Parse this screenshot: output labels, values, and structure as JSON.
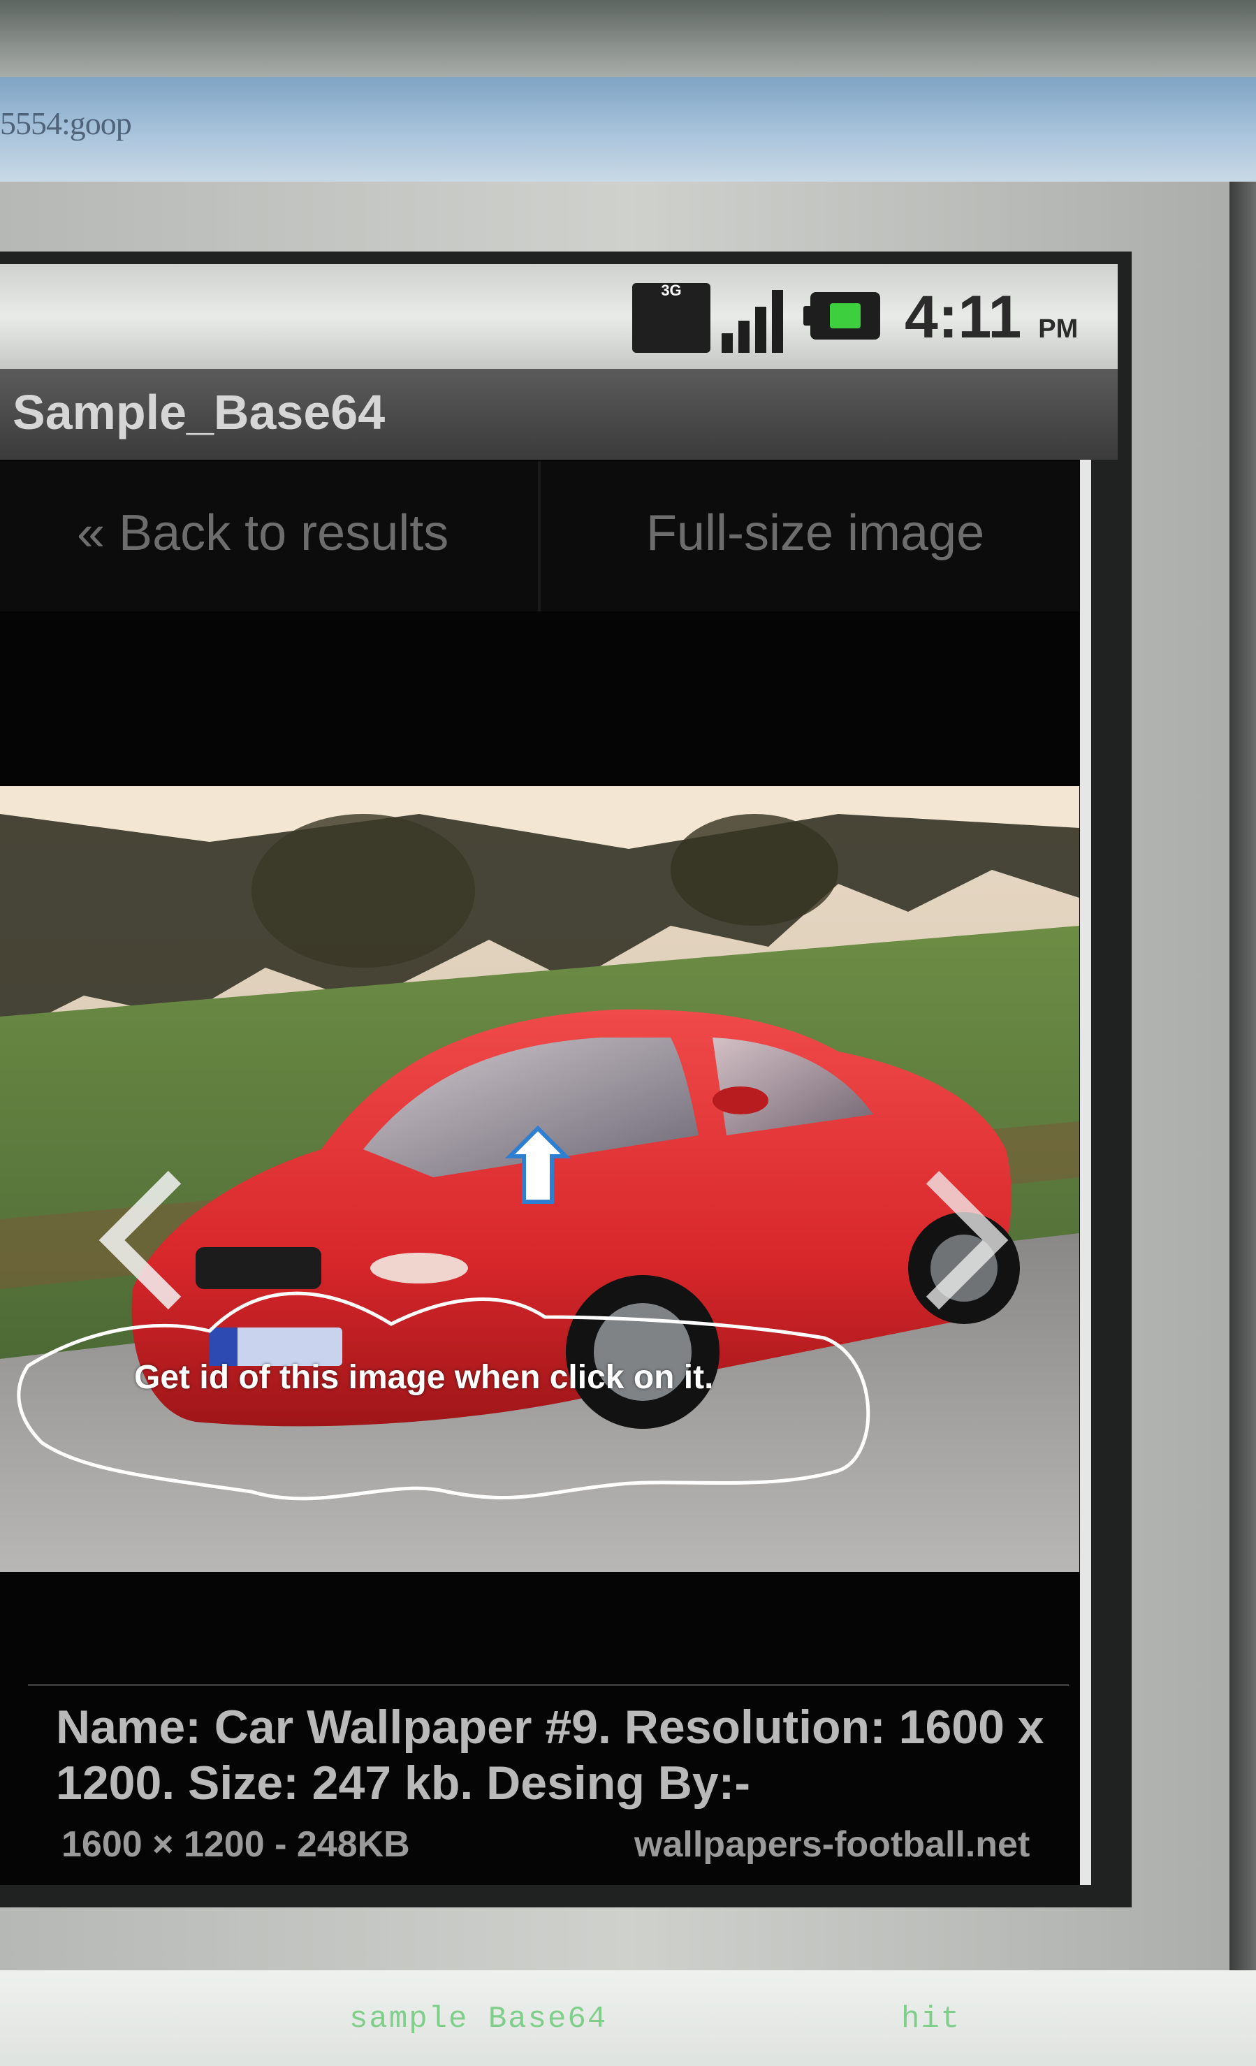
{
  "emulator": {
    "title": "5554:goop",
    "taskbar": [
      "sample Base64",
      "hit"
    ]
  },
  "status_bar": {
    "network": "3G",
    "time": "4:11",
    "ampm": "PM"
  },
  "app": {
    "title": "Sample_Base64"
  },
  "nav": {
    "back_label": "« Back to results",
    "full_size_label": "Full-size image"
  },
  "image": {
    "subject": "red sports car on road",
    "annotation": "Get id of this image when click on it."
  },
  "caption": {
    "main": "Name: Car Wallpaper #9. Resolution: 1600 x 1200. Size: 247 kb. Desing By:-",
    "dimensions": "1600 × 1200 - 248KB",
    "source": "wallpapers-football.net"
  },
  "colors": {
    "car": "#d8272b",
    "background": "#050505",
    "annotation": "#ffffff"
  }
}
